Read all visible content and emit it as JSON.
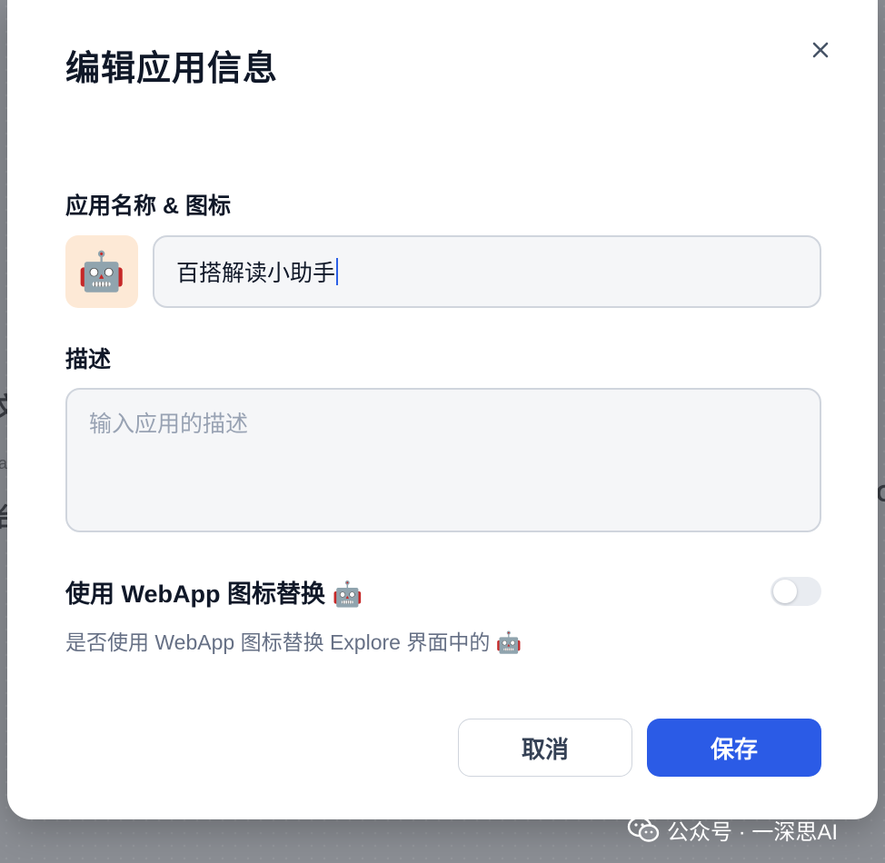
{
  "background": {
    "fragments": [
      "文",
      "ja",
      "台",
      "C"
    ]
  },
  "modal": {
    "title": "编辑应用信息",
    "close_icon": "close-icon"
  },
  "form": {
    "name_label": "应用名称 & 图标",
    "app_icon": "🤖",
    "name_value": "百搭解读小助手",
    "desc_label": "描述",
    "desc_placeholder": "输入应用的描述",
    "desc_value": "",
    "webapp_icon_label": "使用 WebApp 图标替换 🤖",
    "webapp_icon_hint": "是否使用 WebApp 图标替换 Explore 界面中的 🤖",
    "webapp_icon_enabled": false
  },
  "actions": {
    "cancel_label": "取消",
    "save_label": "保存"
  },
  "watermark": {
    "text": "公众号 · 一深思AI",
    "icon": "wechat-icon"
  },
  "colors": {
    "primary": "#2B5BE6",
    "icon_bg": "#FDE9D6",
    "input_bg": "#F5F6F8",
    "border": "#D0D5DD"
  }
}
